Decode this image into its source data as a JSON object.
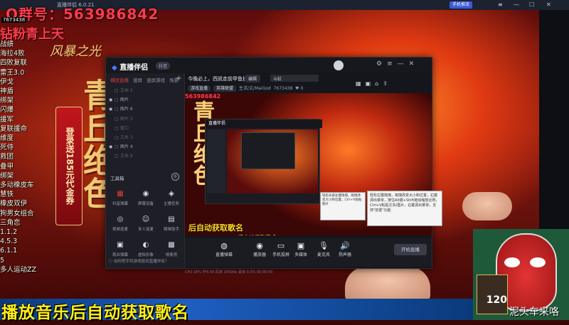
{
  "window_top_title": "直播伴侣 6.0.21",
  "top_button": "手机推流",
  "overlay": {
    "qq_group": "Q群号：563986842",
    "diamond": "钻粉青上天",
    "room_id": "7673438",
    "game_logo": "风暴之光",
    "big_chars": "青丘绝色",
    "promo": "登录送185元代金券",
    "bottom_banner": "播放音乐后自动获取歌名",
    "streamer_name": "泥头车来咯",
    "card_number": "120"
  },
  "side_list": [
    "战绩",
    "海拉4败",
    "四败复联",
    "雷王3.0",
    "伊戈",
    "神盾",
    "绑架",
    "闪爆",
    "援军",
    "复联援命",
    "维度",
    "死侍",
    "救团",
    "叠甲",
    "绑架",
    "多动橡皮车",
    "慧铁",
    "橡皮双伊",
    "狗男女组合",
    "三角恋",
    "1.1.2",
    "4.5.3",
    "6.1.1",
    "5",
    "多人运动ZZ"
  ],
  "right_col": [
    "选",
    "欢",
    "配",
    "色"
  ],
  "app": {
    "logo_text": "直播伴侣",
    "version": "抖音",
    "scene_tabs": [
      {
        "label": "横屏直播",
        "active": true
      },
      {
        "label": "竖屏",
        "active": false
      },
      {
        "label": "竖屏游戏",
        "active": false
      },
      {
        "label": "场景",
        "active": false
      }
    ],
    "sources": [
      {
        "label": "文本 5",
        "dim": true
      },
      {
        "label": "图片",
        "dim": false
      },
      {
        "label": "图片 6",
        "dim": false
      },
      {
        "label": "图片 3",
        "dim": true
      },
      {
        "label": "窗口",
        "dim": true
      },
      {
        "label": "文本 3",
        "dim": true
      },
      {
        "label": "图片 4",
        "dim": false
      },
      {
        "label": "文本 8",
        "dim": true
      }
    ],
    "toolbox_title": "工具箱",
    "tools": [
      {
        "label": "抖音弹幕",
        "icon": "▦",
        "red": true
      },
      {
        "label": "屏幕设备",
        "icon": "◉",
        "red": false
      },
      {
        "label": "主播任务",
        "icon": "◈",
        "red": false
      },
      {
        "label": "视频连麦",
        "icon": "◎",
        "red": false
      },
      {
        "label": "多人连麦",
        "icon": "☺",
        "red": false
      },
      {
        "label": "榜单助手",
        "icon": "▤",
        "red": false
      },
      {
        "label": "观众弹幕",
        "icon": "▣",
        "red": false
      },
      {
        "label": "虚拟形象",
        "icon": "◐",
        "red": false
      },
      {
        "label": "排麦房",
        "icon": "▩",
        "red": false
      }
    ],
    "tips": "如何把手机游戏投到直播伴侣？",
    "stream_title": "今晚必上，西凯走前甲鱼操",
    "edit_label": "编辑",
    "search_value": "斗虹",
    "meta": {
      "category": "游戏直播",
      "sub": "英雄联盟",
      "uid": "生活/文/MaiGod",
      "fans": "7673438",
      "likes": "0"
    },
    "preview_qq": "563986842",
    "preview_sub": "后自动获取歌名",
    "live_tools": [
      {
        "label": "直播弹幕",
        "icon": "◍"
      },
      {
        "label": "播放器",
        "icon": "◉"
      },
      {
        "label": "手机投屏",
        "icon": "▭"
      },
      {
        "label": "多媒体",
        "icon": "▣"
      },
      {
        "label": "麦克风",
        "icon": "🎙"
      },
      {
        "label": "扬声器",
        "icon": "🔊"
      }
    ],
    "start_label": "开始直播",
    "tooltip_short": "轻松长按左键拖拽，拖拽改变大小和位置，Ctrl+V粘贴图片",
    "tooltip_long": "轻松左键拖拽，拖拽改变大小和位置，右键调出菜单，按住Alt键+Shift拖动缩放比例，Ctrl+V粘贴文本/图片，右键调出菜单，支持\"前置\"功能",
    "status": "CPU 16%   FPS 60   码率 2050kb   丢帧 0.0%   00:00:00"
  }
}
